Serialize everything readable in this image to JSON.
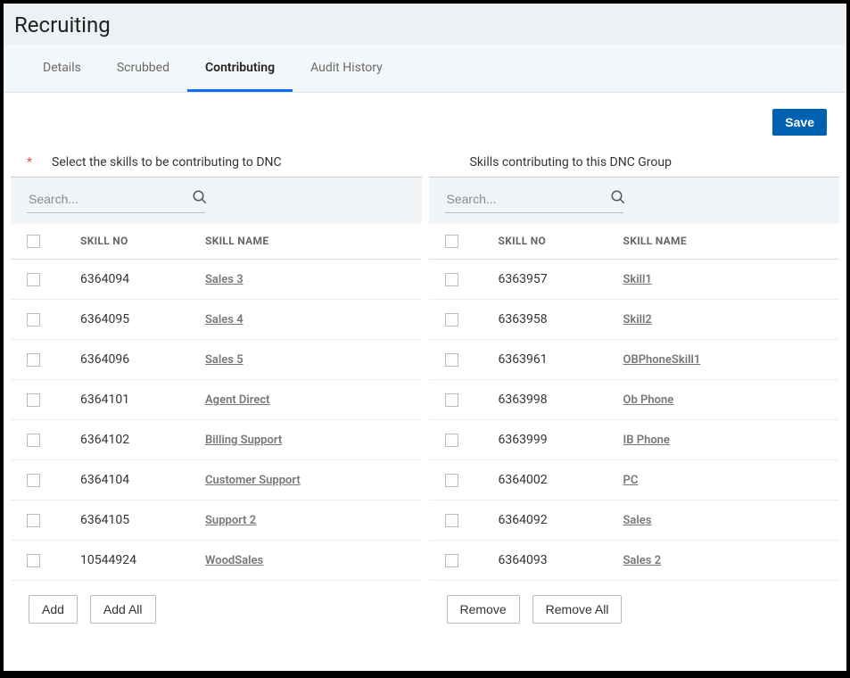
{
  "page_title": "Recruiting",
  "tabs": [
    {
      "label": "Details",
      "active": false
    },
    {
      "label": "Scrubbed",
      "active": false
    },
    {
      "label": "Contributing",
      "active": true
    },
    {
      "label": "Audit History",
      "active": false
    }
  ],
  "save_label": "Save",
  "left_panel": {
    "title": "Select the skills to be contributing to DNC",
    "required": true,
    "search_placeholder": "Search...",
    "columns": {
      "no": "SKILL NO",
      "name": "SKILL NAME"
    },
    "rows": [
      {
        "no": "6364094",
        "name": "Sales 3"
      },
      {
        "no": "6364095",
        "name": "Sales 4"
      },
      {
        "no": "6364096",
        "name": "Sales 5"
      },
      {
        "no": "6364101",
        "name": "Agent Direct"
      },
      {
        "no": "6364102",
        "name": "Billing Support"
      },
      {
        "no": "6364104",
        "name": "Customer Support"
      },
      {
        "no": "6364105",
        "name": "Support 2"
      },
      {
        "no": "10544924",
        "name": "WoodSales"
      }
    ],
    "actions": {
      "add": "Add",
      "add_all": "Add All"
    }
  },
  "right_panel": {
    "title": "Skills contributing to this DNC Group",
    "required": false,
    "search_placeholder": "Search...",
    "columns": {
      "no": "SKILL NO",
      "name": "SKILL NAME"
    },
    "rows": [
      {
        "no": "6363957",
        "name": "Skill1"
      },
      {
        "no": "6363958",
        "name": "Skill2"
      },
      {
        "no": "6363961",
        "name": "OBPhoneSkill1"
      },
      {
        "no": "6363998",
        "name": "Ob Phone"
      },
      {
        "no": "6363999",
        "name": "IB Phone"
      },
      {
        "no": "6364002",
        "name": "PC"
      },
      {
        "no": "6364092",
        "name": "Sales"
      },
      {
        "no": "6364093",
        "name": "Sales 2"
      }
    ],
    "actions": {
      "remove": "Remove",
      "remove_all": "Remove All"
    }
  }
}
